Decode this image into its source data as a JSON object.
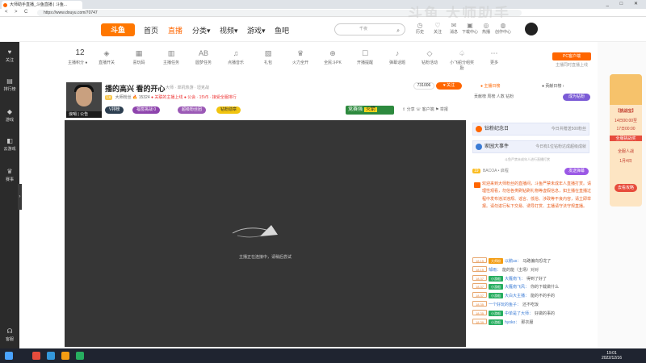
{
  "browser": {
    "tab_title": "大师助手直播_斗鱼直播 | 斗鱼...",
    "url": "https://www.douyu.com/70747",
    "nav_back": "<",
    "nav_forward": ">",
    "nav_reload": "C",
    "win_controls": "_ □ ✕"
  },
  "watermark": "斗鱼  大师助手",
  "topnav": {
    "logo": "斗鱼",
    "items": [
      {
        "label": "首页"
      },
      {
        "label": "直播"
      },
      {
        "label": "分类▾"
      },
      {
        "label": "视频▾"
      },
      {
        "label": "游戏▾"
      },
      {
        "label": "鱼吧"
      }
    ],
    "search_placeholder": "千夜",
    "search_icon": "⌕",
    "icons": [
      {
        "glyph": "◷",
        "label": "历史"
      },
      {
        "glyph": "♡",
        "label": "关注"
      },
      {
        "glyph": "✉",
        "label": "消息"
      },
      {
        "glyph": "▣",
        "label": "下载中心"
      },
      {
        "glyph": "◎",
        "label": "热播"
      },
      {
        "glyph": "◍",
        "label": "创作中心"
      }
    ]
  },
  "leftbar": [
    {
      "glyph": "♥",
      "label": "关注"
    },
    {
      "glyph": "▤",
      "label": "排行榜"
    },
    {
      "glyph": "◆",
      "label": "游戏"
    },
    {
      "glyph": "◧",
      "label": "云游戏"
    },
    {
      "glyph": "♛",
      "label": "赛事"
    },
    {
      "glyph": "☊",
      "label": "客服"
    }
  ],
  "leftbar_arrow": "›",
  "stats": {
    "rank_number": "12",
    "rank_label": "主播积分 ●",
    "items": [
      {
        "glyph": "◈",
        "label": "直播开关"
      },
      {
        "glyph": "▦",
        "label": "喜玩码"
      },
      {
        "glyph": "▥",
        "label": "主播任务"
      },
      {
        "glyph": "AB",
        "label": "圆梦任务"
      },
      {
        "glyph": "♫",
        "label": "点播音乐"
      },
      {
        "glyph": "▧",
        "label": "礼包"
      },
      {
        "glyph": "♛",
        "label": "火力全开"
      },
      {
        "glyph": "⊕",
        "label": "全民斗PK"
      },
      {
        "glyph": "☐",
        "label": "开播提醒"
      },
      {
        "glyph": "♪",
        "label": "弹幕话题"
      },
      {
        "glyph": "◇",
        "label": "钻粉活动"
      },
      {
        "glyph": "♤",
        "label": "小飞船分组奖励"
      },
      {
        "glyph": "⋯",
        "label": "更多"
      }
    ],
    "pc_button": "PC客户端",
    "pc_sub": "主播同时直播上线"
  },
  "stream": {
    "avatar_caption": "浪哨 | 公告",
    "title": "播的高兴 看的开心",
    "category": "大师 · 单机热游 · 坦克战",
    "line2_level": "Lv",
    "line2_name": "大师粉丝",
    "line2_hot": "15324",
    "line2_red": "● 关联的主播上线",
    "line2_extra": "● 公会 · 15V5 · 接受全服排行",
    "pills": [
      {
        "label": "V排榜",
        "color": "#2c3e50"
      },
      {
        "label": "福签挑战  0",
        "color": "#8e44ad"
      },
      {
        "label": "超级粉丝团",
        "color": "#9b59b6"
      },
      {
        "label": "钻粉勋章",
        "color": "#f1c40f"
      }
    ],
    "viewers": "731006",
    "follow": "♥ 关注",
    "competition_label": "竞赛强",
    "competition_badge": "火箭",
    "share_row": "⇧ 分享  ☏ 客户端  ⚑ 举报"
  },
  "player": {
    "message": "主播正在连接中，请稍后尝试"
  },
  "rpanel": {
    "tab1": "● 主播日榜",
    "tab2": "● 贡献日榜 ›",
    "sub": "贡献榜  周榜  人数  钻粉",
    "sub_button": "成为钻粉",
    "box1": "钻粉纪念日",
    "box1_right": "今日共赠送500粉丝",
    "box2": "家园大事件",
    "box2_right": "今日有1位钻粉达成超级成就",
    "gap_text": "斗鱼严禁未成年人进行直播打赏",
    "chat_top_level": "19",
    "chat_top_name": "BACOA • 启程",
    "chat_top_button": "发送弹幕",
    "notice": "欢迎来到大师粉丝的直播间，斗鱼严禁未成年人直播打赏。请理性观看，勿信各类刷钻刷礼物等虚假信息，如主播在直播过程中发布违法违规、谣言、低俗、涉政等不良内容，请立即举报。请勿进行私下交易、诱导打赏、主播请守法守规直播。",
    "chat": [
      {
        "lv": "18.15",
        "badge": "大师粉",
        "badge_green": false,
        "name": "以鹅us：",
        "text": "马路偏向恐龙了"
      },
      {
        "lv": "18.15",
        "badge": "",
        "badge_green": false,
        "name": "邹雨：",
        "text": "能的能（主场）对对"
      },
      {
        "lv": "18.37",
        "badge": "小游船",
        "badge_green": true,
        "name": "大雁南飞：",
        "text": "得到了好了"
      },
      {
        "lv": "18.37",
        "badge": "小游船",
        "badge_green": true,
        "name": "大雁南飞风：",
        "text": "你的下载做什么"
      },
      {
        "lv": "18.37",
        "badge": "小游船",
        "badge_green": true,
        "name": "大白大主播：",
        "text": "能的不的手的"
      },
      {
        "lv": "18.35",
        "badge": "",
        "badge_green": false,
        "name": "一个好玩的鱼子：",
        "text": "还不吃饭"
      },
      {
        "lv": "18.35",
        "badge": "小游船",
        "badge_green": true,
        "name": "中单是了大师：",
        "text": "好做的事的"
      },
      {
        "lv": "18.39",
        "badge": "小游船",
        "badge_green": true,
        "name": "hyoko：",
        "text": "那衣服"
      }
    ]
  },
  "ad": {
    "t1": "【挑战宝】",
    "t2": "14日00:00至",
    "t3": "17日00:00",
    "t4": "全服挑战奖",
    "t5": "全服人战",
    "t6": "1月4日",
    "btn": "去看攻略"
  },
  "taskbar": {
    "time": "19:01",
    "date": "2022/12/16"
  }
}
